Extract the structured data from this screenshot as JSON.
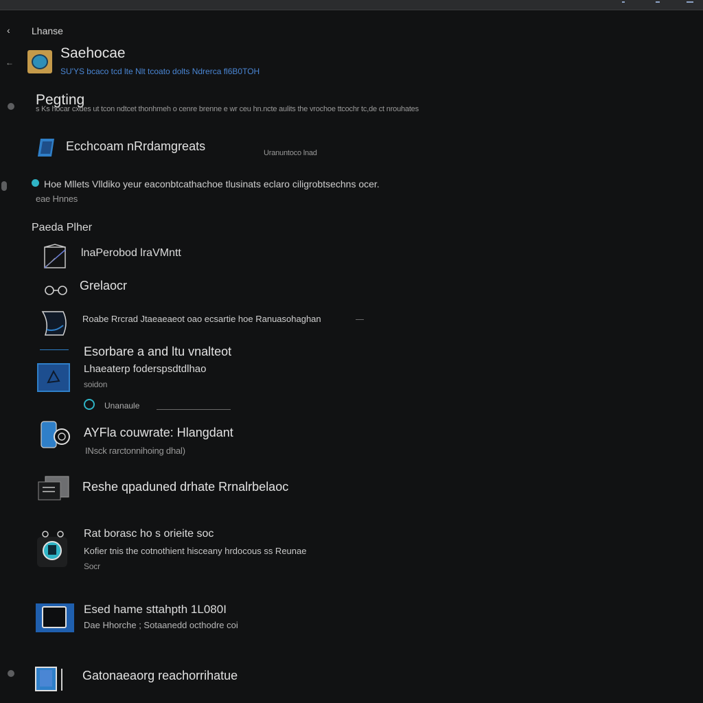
{
  "header": {
    "back_label": "Lhanse"
  },
  "app": {
    "name": "Saehocae",
    "meta": "SU'YS bcaco tcd lte Nlt tcoato dolts Ndrerca fl6B0TOH"
  },
  "setting": {
    "title": "Pegting",
    "description": "s Ks hocar cxdes ut tcon ndtcet thonhmeh o cenre brenne e wr ceu hn.ncte aulits the vrochoe ttcochr tc,de ct nrouhates"
  },
  "feature": {
    "title": "Ecchcoam nRrdamgreats",
    "badge": "Uranuntoco lnad",
    "info_line1": "Hoe Mllets Vlldiko yeur eaconbtcathachoe tlusinats eclaro ciligrobtsechns ocer.",
    "info_line2": "eae Hnnes"
  },
  "section": {
    "title": "Paeda Plher"
  },
  "items": [
    {
      "title": "lnaPerobod lraVMntt"
    },
    {
      "title": "Grelaocr"
    },
    {
      "title": "Roabe Rrcrad Jtaeaeaeot oao ecsartie hoe Ranuasohaghan"
    },
    {
      "title": "Esorbare a and ltu vnalteot",
      "subtitle": "Lhaeaterp foderspsdtdlhao",
      "subtitle2": "soidon",
      "link": "Unanaule"
    },
    {
      "title": "AYFla couwrate: Hlangdant",
      "subtitle": "INsck rarctonnihoing dhal)"
    },
    {
      "title": "Reshe qpaduned drhate Rrnalrbelaoc"
    },
    {
      "title": "Rat borasc ho s orieite soc",
      "subtitle": "Kofier tnis the cotnothient hisceany hrdocous ss Reunae",
      "subtitle2": "Socr"
    },
    {
      "title": "Esed hame sttahpth 1L080I",
      "subtitle": "Dae Hhorche ; Sotaanedd octhodre coi"
    },
    {
      "title": "Gatonaeaorg reachorrihatue"
    }
  ],
  "colors": {
    "background": "#111213",
    "accent": "#2f7fc8",
    "teal": "#2fb4c6",
    "text": "#dcdcdc",
    "muted": "#9a9a9a"
  }
}
